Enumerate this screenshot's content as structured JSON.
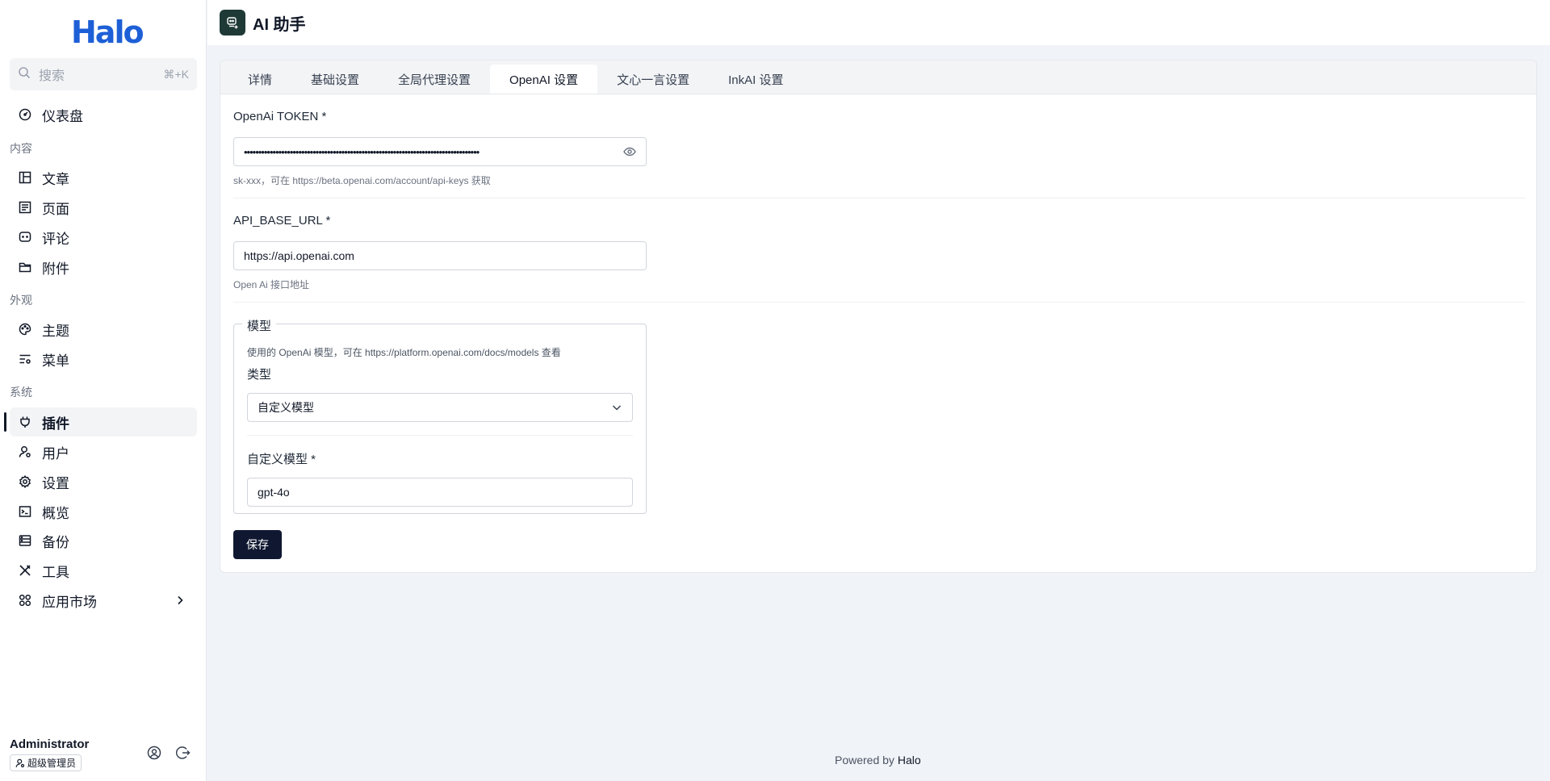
{
  "sidebar": {
    "logo": "Halo",
    "search": {
      "placeholder": "搜索",
      "shortcut": "⌘+K"
    },
    "dashboard": "仪表盘",
    "groups": {
      "content": "内容",
      "appearance": "外观",
      "system": "系统"
    },
    "items": {
      "posts": "文章",
      "pages": "页面",
      "comments": "评论",
      "attachments": "附件",
      "themes": "主题",
      "menus": "菜单",
      "plugins": "插件",
      "users": "用户",
      "settings": "设置",
      "overview": "概览",
      "backup": "备份",
      "tools": "工具",
      "market": "应用市场"
    },
    "user": {
      "name": "Administrator",
      "role": "超级管理员"
    }
  },
  "header": {
    "title": "AI 助手"
  },
  "tabs": [
    "详情",
    "基础设置",
    "全局代理设置",
    "OpenAI 设置",
    "文心一言设置",
    "InkAI 设置"
  ],
  "active_tab": "OpenAI 设置",
  "form": {
    "token": {
      "label": "OpenAi TOKEN *",
      "value": "••••••••••••••••••••••••••••••••••••••••••••••••••••••••••••••••••••••••••••••••••",
      "help": "sk-xxx，可在 https://beta.openai.com/account/api-keys 获取"
    },
    "base_url": {
      "label": "API_BASE_URL *",
      "value": "https://api.openai.com",
      "help": "Open Ai 接口地址"
    },
    "model": {
      "legend": "模型",
      "help": "使用的 OpenAi 模型，可在 https://platform.openai.com/docs/models 查看",
      "type_label": "类型",
      "type_value": "自定义模型",
      "custom_label": "自定义模型 *",
      "custom_value": "gpt-4o"
    },
    "save": "保存"
  },
  "footer": {
    "prefix": "Powered by",
    "brand": "Halo"
  }
}
